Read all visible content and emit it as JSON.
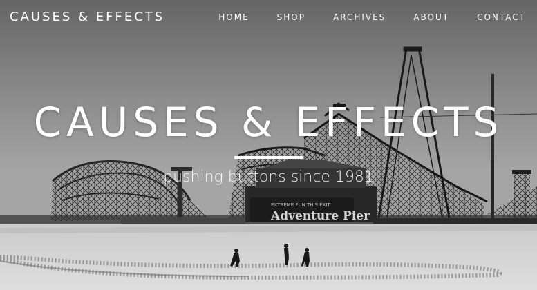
{
  "site": {
    "brand": "CAUSES & EFFECTS"
  },
  "nav": {
    "items": [
      {
        "label": "HOME"
      },
      {
        "label": "SHOP"
      },
      {
        "label": "ARCHIVES"
      },
      {
        "label": "ABOUT"
      },
      {
        "label": "CONTACT"
      }
    ]
  },
  "hero": {
    "title": "CAUSES & EFFECTS",
    "subtitle": "pushing buttons since 1981",
    "sign_top": "EXTREME FUN THIS EXIT",
    "sign_main": "Adventure Pier"
  }
}
